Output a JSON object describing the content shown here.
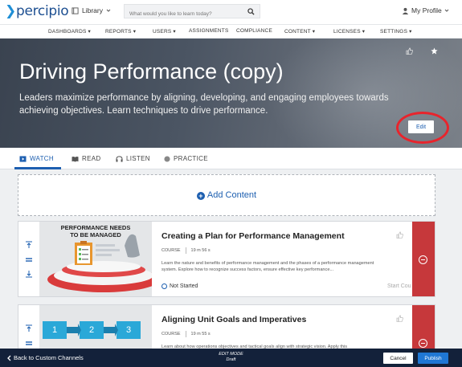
{
  "header": {
    "logo_text": "percipio",
    "library_label": "Library",
    "search_placeholder": "What would you like to learn today?",
    "profile_label": "My Profile"
  },
  "nav": {
    "items": [
      "DASHBOARDS",
      "REPORTS",
      "USERS",
      "ASSIGNMENTS",
      "COMPLIANCE",
      "CONTENT",
      "LICENSES",
      "SETTINGS"
    ]
  },
  "hero": {
    "title": "Driving Performance (copy)",
    "description": "Leaders maximize performance by aligning, developing, and engaging employees towards achieving objectives. Learn techniques to drive performance.",
    "edit_label": "Edit"
  },
  "tabs": [
    "WATCH",
    "READ",
    "LISTEN",
    "PRACTICE"
  ],
  "add_content_label": "Add Content",
  "courses": [
    {
      "title": "Creating a Plan for Performance Management",
      "type": "COURSE",
      "duration": "19 m 56 s",
      "description": "Learn the nature and benefits of performance management and the phases of a performance management system. Explore how to recognize success factors, ensure effective key performance...",
      "status": "Not Started",
      "action": "Start Cou",
      "thumb_text_line1": "PERFORMANCE NEEDS",
      "thumb_text_line2": "TO BE MANAGED"
    },
    {
      "title": "Aligning Unit Goals and Imperatives",
      "type": "COURSE",
      "duration": "19 m 55 s",
      "description": "Learn about how operations objectives and tactical goals align with strategic vision. Apply this",
      "thumb_steps": [
        "1",
        "2",
        "3"
      ]
    }
  ],
  "footer": {
    "back_label": "Back to Custom Channels",
    "mode_label": "EDIT MODE",
    "mode_state": "Draft",
    "cancel_label": "Cancel",
    "publish_label": "Publish"
  },
  "colors": {
    "brand_blue": "#1d5fb0",
    "remove_red": "#c6383b",
    "footer_navy": "#13213a",
    "highlight_red": "#e8242c"
  }
}
